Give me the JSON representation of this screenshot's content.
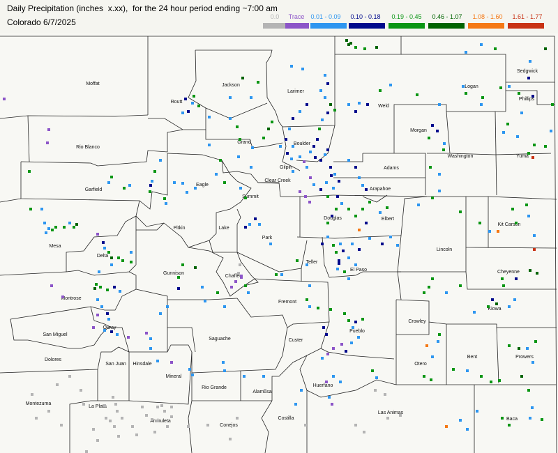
{
  "header": {
    "title": "Daily Precipitation (inches  x.xx),  for the 24 hour period ending ~7:00 am",
    "subtitle": "Colorado 6/7/2025"
  },
  "legend": [
    {
      "label": "0.0",
      "color": "#b4b4b4"
    },
    {
      "label": "Trace",
      "color": "#8c55c8"
    },
    {
      "label": "0.01 - 0.09",
      "color": "#2e96f0"
    },
    {
      "label": "0.10 - 0.18",
      "color": "#000a8c"
    },
    {
      "label": "0.19 - 0.45",
      "color": "#0a9614"
    },
    {
      "label": "0.46 - 1.07",
      "color": "#006400"
    },
    {
      "label": "1.08 - 1.60",
      "color": "#f57814"
    },
    {
      "label": "1.61 - 1.77",
      "color": "#c83214"
    }
  ],
  "counties": {
    "moffat": "Moffat",
    "routt": "Routt",
    "jackson": "Jackson",
    "larimer": "Larimer",
    "weld": "Weld",
    "logan": "Logan",
    "sedgwick": "Sedgwick",
    "phillips": "Phillips",
    "morgan": "Morgan",
    "rio_blanco": "Rio Blanco",
    "grand": "Grand",
    "boulder": "Boulder",
    "washington": "Washington",
    "yuma": "Yuma",
    "adams": "Adams",
    "garfield": "Garfield",
    "eagle": "Eagle",
    "gilpin": "Gilpin",
    "clear_creek": "Clear Creek",
    "arapahoe": "Arapahoe",
    "summit": "Summit",
    "mesa": "Mesa",
    "pitkin": "Pitkin",
    "lake": "Lake",
    "douglas": "Douglas",
    "elbert": "Elbert",
    "kit_carson": "Kit Carson",
    "park": "Park",
    "delta": "Delta",
    "lincoln": "Lincoln",
    "teller": "Teller",
    "el_paso": "El Paso",
    "gunnison": "Gunnison",
    "chaffee": "Chaffee",
    "cheyenne": "Cheyenne",
    "montrose": "Montrose",
    "fremont": "Fremont",
    "kiowa": "Kiowa",
    "ouray": "Ouray",
    "crowley": "Crowley",
    "san_miguel": "San Miguel",
    "saguache": "Saguache",
    "custer": "Custer",
    "pueblo": "Pueblo",
    "bent": "Bent",
    "prowers": "Prowers",
    "dolores": "Dolores",
    "san_juan": "San Juan",
    "hinsdale": "Hinsdale",
    "otero": "Otero",
    "mineral": "Mineral",
    "rio_grande": "Rio Grande",
    "alamosa": "Alamosa",
    "huerfano": "Huerfano",
    "montezuma": "Montezuma",
    "la_plata": "La Plata",
    "archuleta": "Archuleta",
    "conejos": "Conejos",
    "costilla": "Costilla",
    "las_animas": "Las Animas",
    "baca": "Baca"
  }
}
